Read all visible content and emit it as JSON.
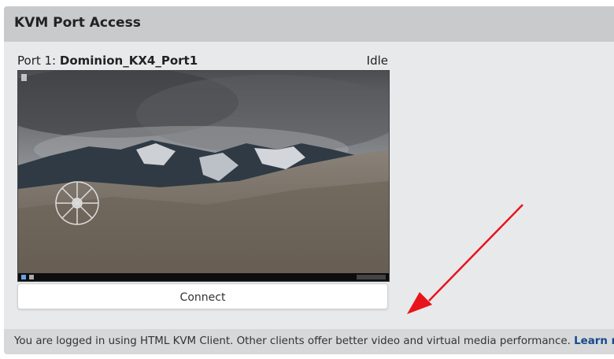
{
  "panel": {
    "title": "KVM Port Access"
  },
  "port": {
    "prefix": "Port 1:",
    "name": "Dominion_KX4_Port1",
    "status": "Idle"
  },
  "preview": {
    "description_icon": "remote-desktop-thumbnail"
  },
  "actions": {
    "connect_label": "Connect"
  },
  "footer": {
    "message": "You are logged in using HTML KVM Client. Other clients offer better video and virtual media performance.",
    "link_label": "Learn more",
    "trailing": "."
  },
  "colors": {
    "panel_bg": "#e8e9eb",
    "header_bg": "#c8cacc",
    "footer_bg": "#d6d8da",
    "link": "#154a8a",
    "annotation_arrow": "#e8141c"
  }
}
